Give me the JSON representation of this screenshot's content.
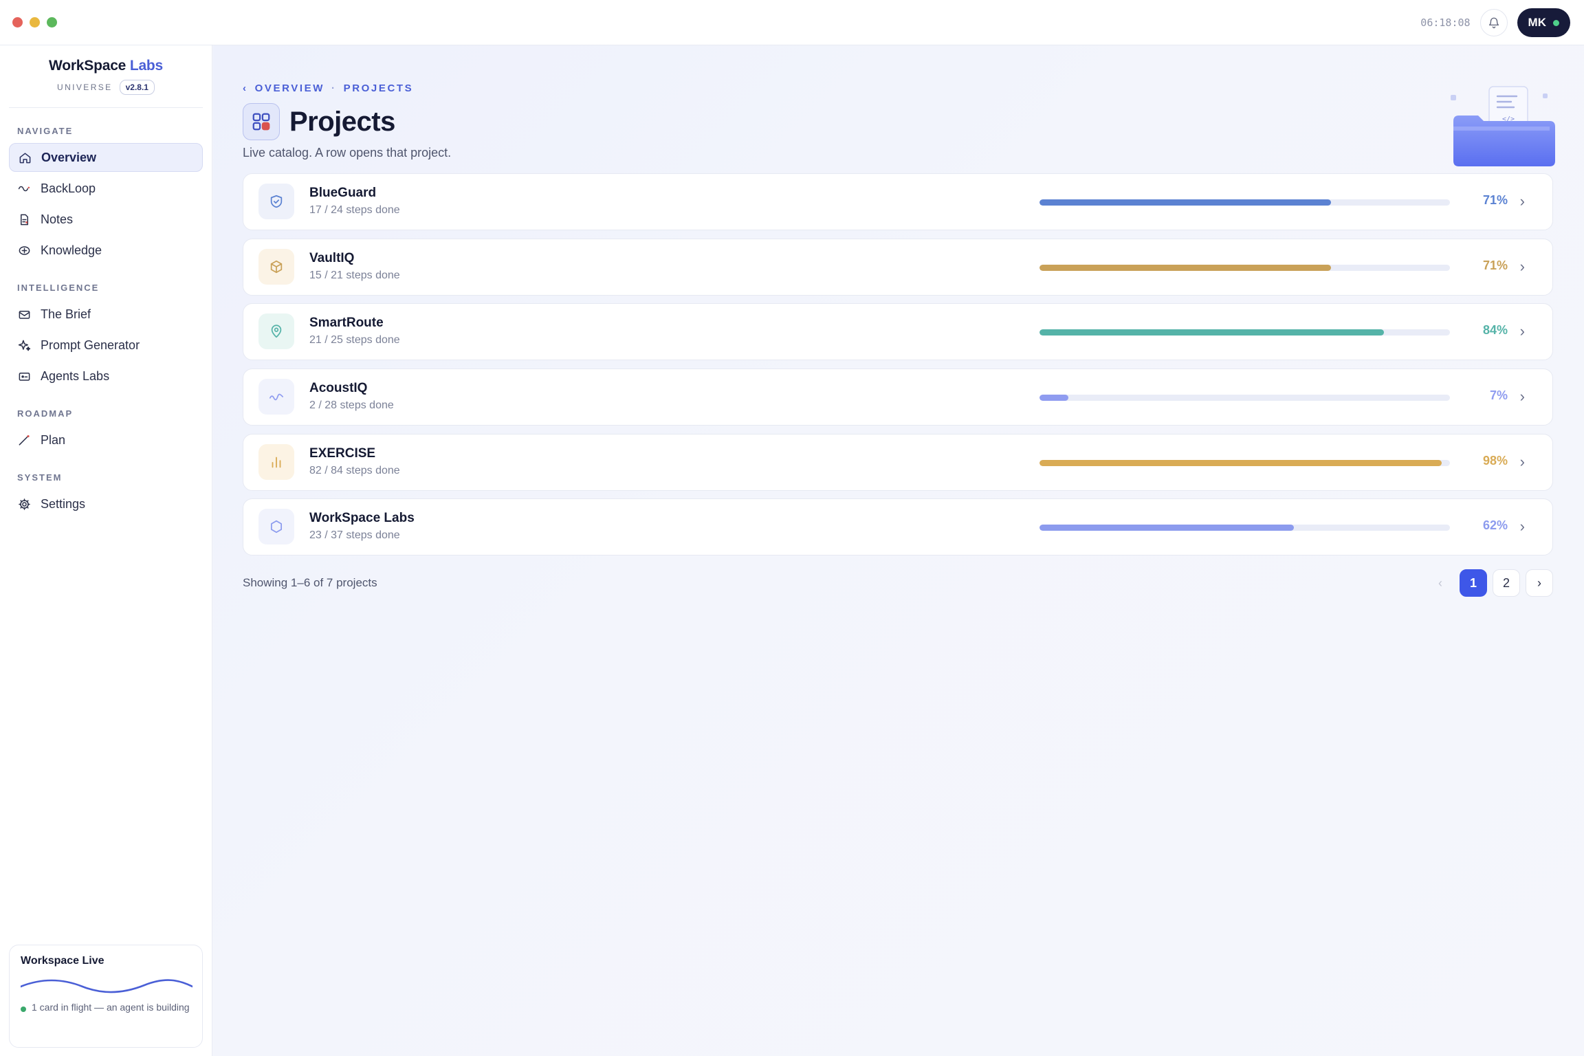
{
  "titlebar": {
    "clock": "06:18:08",
    "user_initials": "MK"
  },
  "brand": {
    "name_primary": "WorkSpace",
    "name_accent": "Labs",
    "universe": "UNIVERSE",
    "version": "v2.8.1"
  },
  "nav": {
    "sections": [
      {
        "title": "NAVIGATE",
        "items": [
          "Overview",
          "BackLoop",
          "Notes",
          "Knowledge"
        ]
      },
      {
        "title": "INTELLIGENCE",
        "items": [
          "The Brief",
          "Prompt Generator",
          "Agents Labs"
        ]
      },
      {
        "title": "ROADMAP",
        "items": [
          "Plan"
        ]
      },
      {
        "title": "SYSTEM",
        "items": [
          "Settings"
        ]
      }
    ],
    "active": "Overview"
  },
  "live_card": {
    "title": "Workspace Live",
    "status": "1 card in flight — an agent is building"
  },
  "page": {
    "breadcrumb": [
      "OVERVIEW",
      "PROJECTS"
    ],
    "breadcrumb_sep": "·",
    "breadcrumb_back": "‹",
    "title": "Projects",
    "subtitle": "Live catalog. A row opens that project."
  },
  "projects": [
    {
      "name": "BlueGuard",
      "steps": "17 / 24 steps done",
      "percent": "71%",
      "progress": 0.71,
      "color": "#5b82d2",
      "icon": "shield-icon",
      "icon_bg": "#eef1fa"
    },
    {
      "name": "VaultIQ",
      "steps": "15 / 21 steps done",
      "percent": "71%",
      "progress": 0.71,
      "color": "#c9a158",
      "icon": "box-icon",
      "icon_bg": "#fbf3e6"
    },
    {
      "name": "SmartRoute",
      "steps": "21 / 25 steps done",
      "percent": "84%",
      "progress": 0.84,
      "color": "#55b3a8",
      "icon": "location-pin-icon",
      "icon_bg": "#e9f6f3"
    },
    {
      "name": "AcoustIQ",
      "steps": "2 / 28 steps done",
      "percent": "7%",
      "progress": 0.07,
      "color": "#8f9cf0",
      "icon": "wave-icon",
      "icon_bg": "#f1f3fc"
    },
    {
      "name": "EXERCISE",
      "steps": "82 / 84 steps done",
      "percent": "98%",
      "progress": 0.98,
      "color": "#d9ab55",
      "icon": "bar-chart-icon",
      "icon_bg": "#fcf3e4"
    },
    {
      "name": "WorkSpace Labs",
      "steps": "23 / 37 steps done",
      "percent": "62%",
      "progress": 0.62,
      "color": "#8c9bee",
      "icon": "hexagon-icon",
      "icon_bg": "#f1f3fc"
    }
  ],
  "pagination": {
    "showing": "Showing 1–6 of 7 projects",
    "prev": "‹",
    "pages": [
      "1",
      "2"
    ],
    "current": "1",
    "next": "›"
  },
  "chevron": "›"
}
